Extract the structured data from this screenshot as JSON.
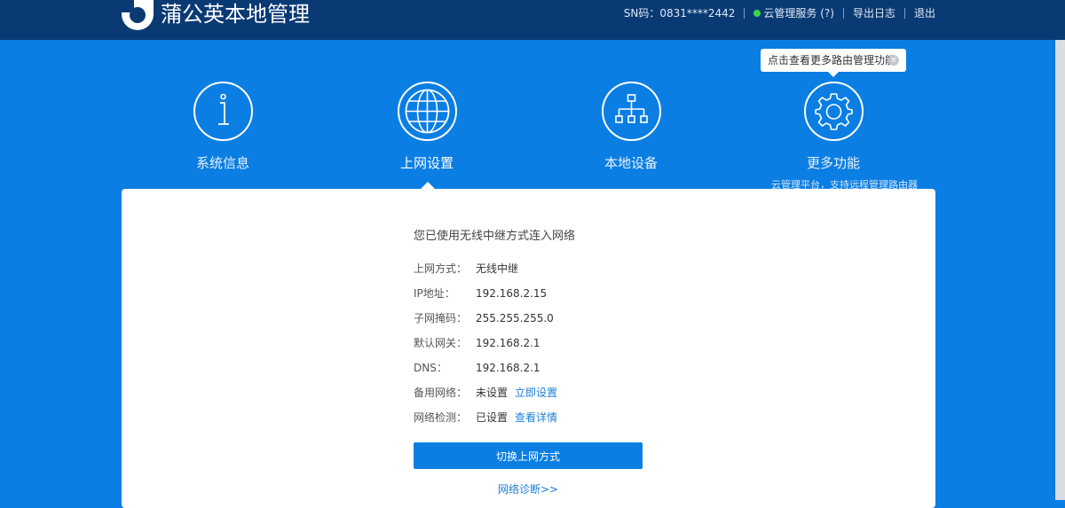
{
  "header": {
    "brand": "蒲公英本地管理",
    "sn": "SN码：0831****2442",
    "cloud_service": "云管理服务 (?)",
    "export_log": "导出日志",
    "logout": "退出"
  },
  "tooltip": {
    "text": "点击查看更多路由管理功能",
    "close": "×"
  },
  "nav": {
    "items": [
      {
        "label": "系统信息",
        "icon": "info-icon"
      },
      {
        "label": "上网设置",
        "icon": "globe-icon",
        "active": true
      },
      {
        "label": "本地设备",
        "icon": "network-tree-icon"
      },
      {
        "label": "更多功能",
        "icon": "gear-icon",
        "sub": "云管理平台，支持远程管理路由器"
      }
    ]
  },
  "status": {
    "intro": "您已使用无线中继方式连入网络",
    "rows": [
      {
        "label": "上网方式：",
        "value": "无线中继"
      },
      {
        "label": "IP地址：",
        "value": "192.168.2.15"
      },
      {
        "label": "子网掩码：",
        "value": "255.255.255.0"
      },
      {
        "label": "默认网关：",
        "value": "192.168.2.1"
      },
      {
        "label": "DNS：",
        "value": "192.168.2.1"
      },
      {
        "label": "备用网络：",
        "value": "未设置",
        "action": "立即设置"
      },
      {
        "label": "网络检测：",
        "value": "已设置",
        "action": "查看详情"
      }
    ],
    "switch_button": "切换上网方式",
    "diagnose_link": "网络诊断>>"
  },
  "colors": {
    "header_bg": "#0a3a74",
    "page_bg": "#0a7ee3",
    "link": "#1a7fd8",
    "status_dot": "#3bd44a"
  }
}
